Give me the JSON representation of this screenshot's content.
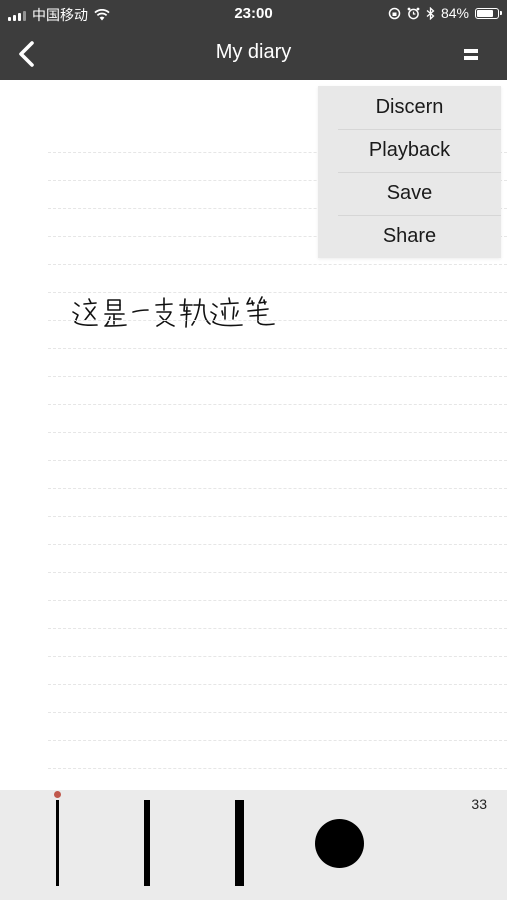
{
  "status_bar": {
    "carrier": "中国移动",
    "time": "23:00",
    "battery": "84%",
    "battery_level": 0.84,
    "icons": [
      "signal-icon",
      "wifi-icon",
      "rotation-lock-icon",
      "alarm-icon",
      "bluetooth-icon",
      "battery-icon"
    ]
  },
  "navbar": {
    "title": "My diary",
    "back_icon": "chevron-left-icon",
    "menu_icon": "menu-icon"
  },
  "menu": {
    "items": [
      {
        "label": "Discern"
      },
      {
        "label": "Playback"
      },
      {
        "label": "Save"
      },
      {
        "label": "Share"
      }
    ]
  },
  "note": {
    "handwritten_text": "这是一支轨迹笔"
  },
  "toolbar": {
    "brush_sizes": [
      "thin",
      "medium",
      "thick",
      "circle"
    ],
    "selected_brush": "thin",
    "stroke_size_value": "33"
  },
  "colors": {
    "header_bg": "#3d3d3d",
    "menu_bg": "#e8e8e8",
    "toolbar_bg": "#ebebeb",
    "selected_indicator": "#c0584c"
  }
}
